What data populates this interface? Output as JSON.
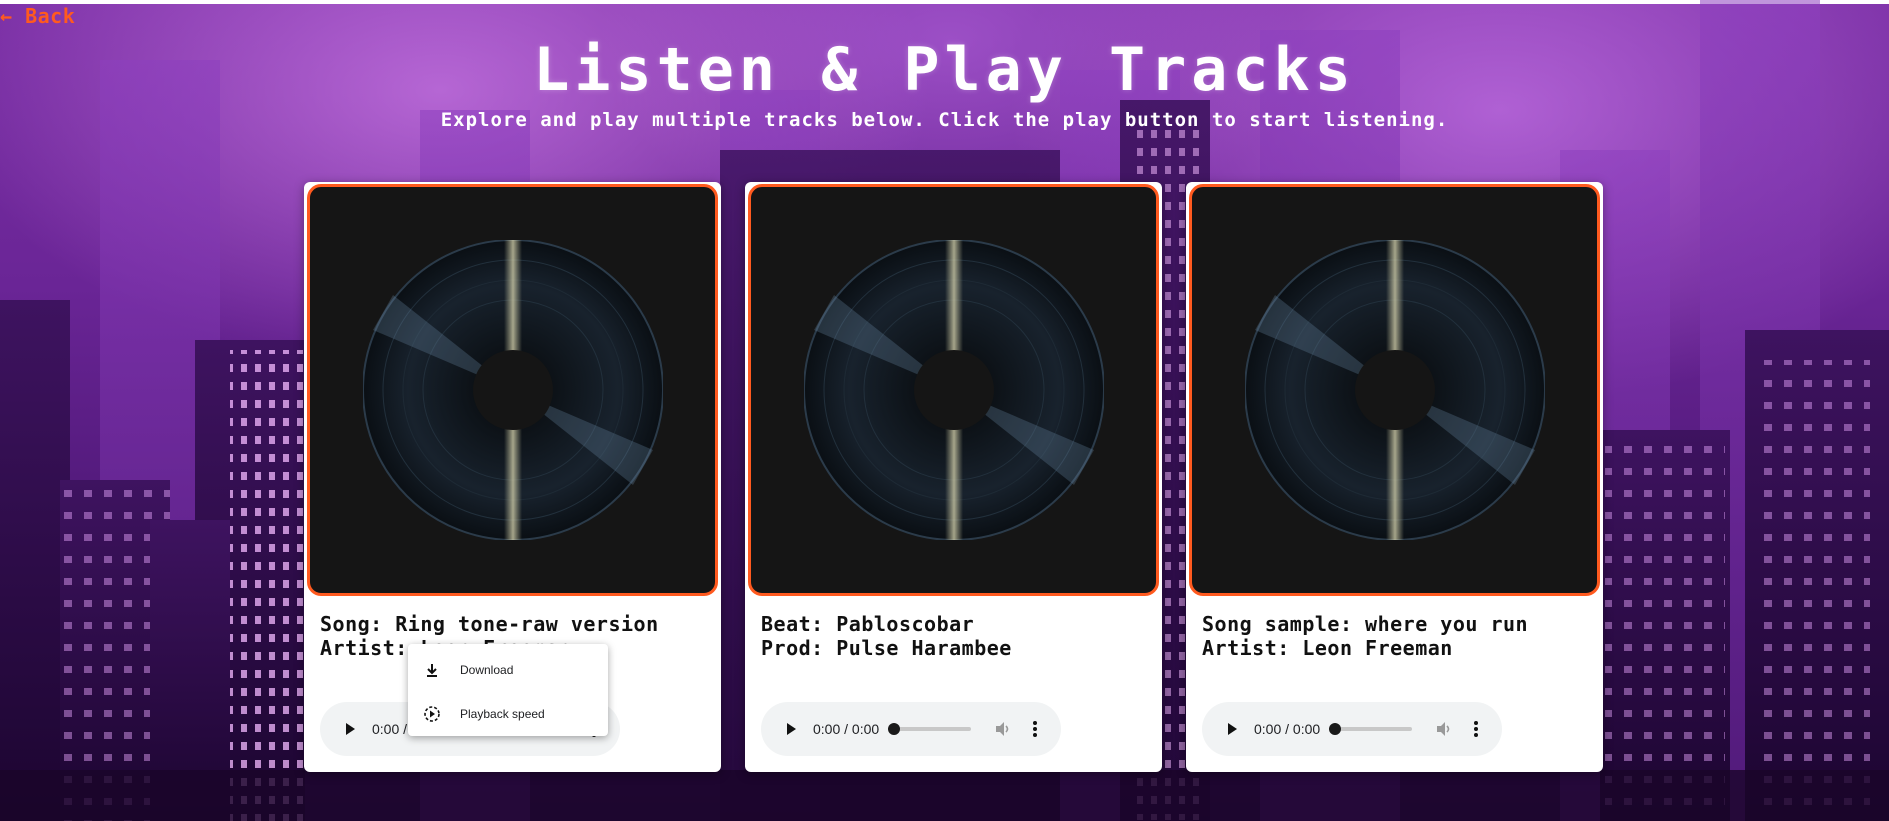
{
  "nav": {
    "back_label": "← Back"
  },
  "header": {
    "title": "Listen & Play Tracks",
    "subtitle": "Explore and play multiple tracks below. Click the play button to start listening."
  },
  "colors": {
    "accent": "#ff5a1f",
    "card": "#ffffff",
    "cover_bg": "#151515",
    "player_bg": "#f1f3f4"
  },
  "tracks": [
    {
      "line1": "Song: Ring tone-raw version",
      "line2": "Artist: Leon Freeman",
      "player": {
        "time": "0:00 / 0:00",
        "progress": 0,
        "icons": [
          "play-icon",
          "volume-icon",
          "more-options-icon"
        ]
      }
    },
    {
      "line1": "Beat: Pabloscobar",
      "line2": "Prod: Pulse Harambee",
      "player": {
        "time": "0:00 / 0:00",
        "progress": 0,
        "icons": [
          "play-icon",
          "volume-icon",
          "more-options-icon"
        ]
      }
    },
    {
      "line1": "Song sample: where you run",
      "line2": "Artist: Leon Freeman",
      "player": {
        "time": "0:00 / 0:00",
        "progress": 0,
        "icons": [
          "play-icon",
          "volume-icon",
          "more-options-icon"
        ]
      }
    }
  ],
  "context_menu": {
    "items": [
      {
        "label": "Download",
        "icon": "download-icon"
      },
      {
        "label": "Playback speed",
        "icon": "playback-speed-icon"
      }
    ]
  }
}
